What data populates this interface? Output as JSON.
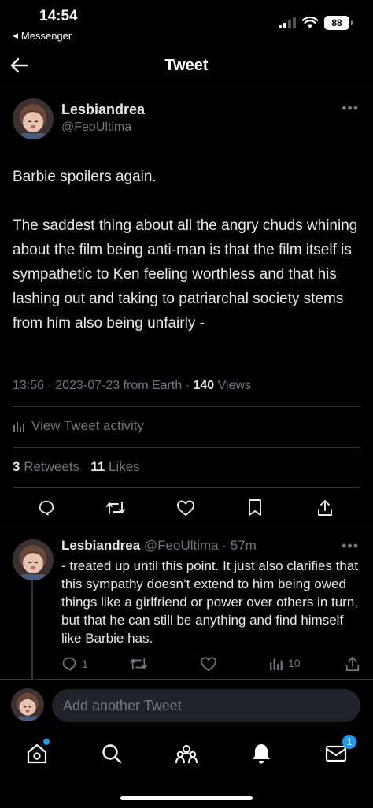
{
  "status_bar": {
    "time": "14:54",
    "back_app_label": "Messenger",
    "battery": "88"
  },
  "header": {
    "title": "Tweet"
  },
  "tweet": {
    "author_name": "Lesbiandrea",
    "author_handle": "@FeoUltima",
    "text": "Barbie spoilers again.\n\nThe saddest thing about all the angry chuds whining about the film being anti-man is that the film itself is sympathetic to Ken feeling worthless and that his lashing out and taking to patriarchal society stems from him also being unfairly -",
    "time": "13:56",
    "date": "2023-07-23",
    "source": "from Earth",
    "views_count": "140",
    "views_label": "Views",
    "activity_label": "View Tweet activity",
    "retweets_count": "3",
    "retweets_label": "Retweets",
    "likes_count": "11",
    "likes_label": "Likes"
  },
  "reply": {
    "author_name": "Lesbiandrea",
    "author_handle": "@FeoUltima",
    "age": "57m",
    "text": "- treated up until this point. It just also clarifies that this sympathy doesn’t extend to him being owed things like a girlfriend or power over others in turn, but that he can still be anything and find himself like Barbie has.",
    "reply_count": "1",
    "views_count": "10"
  },
  "composer": {
    "placeholder": "Add another Tweet"
  },
  "tab_bar": {
    "messages_badge": "1"
  },
  "colors": {
    "background": "#000000",
    "text": "#e7e9ea",
    "secondary": "#71767b",
    "accent": "#1d9bf0",
    "divider": "#2f3336"
  },
  "icons": [
    "arrow-left-icon",
    "more-icon",
    "reply-icon",
    "retweet-icon",
    "like-icon",
    "bookmark-icon",
    "share-icon",
    "analytics-icon",
    "home-icon",
    "search-icon",
    "communities-icon",
    "notifications-icon",
    "messages-icon"
  ]
}
